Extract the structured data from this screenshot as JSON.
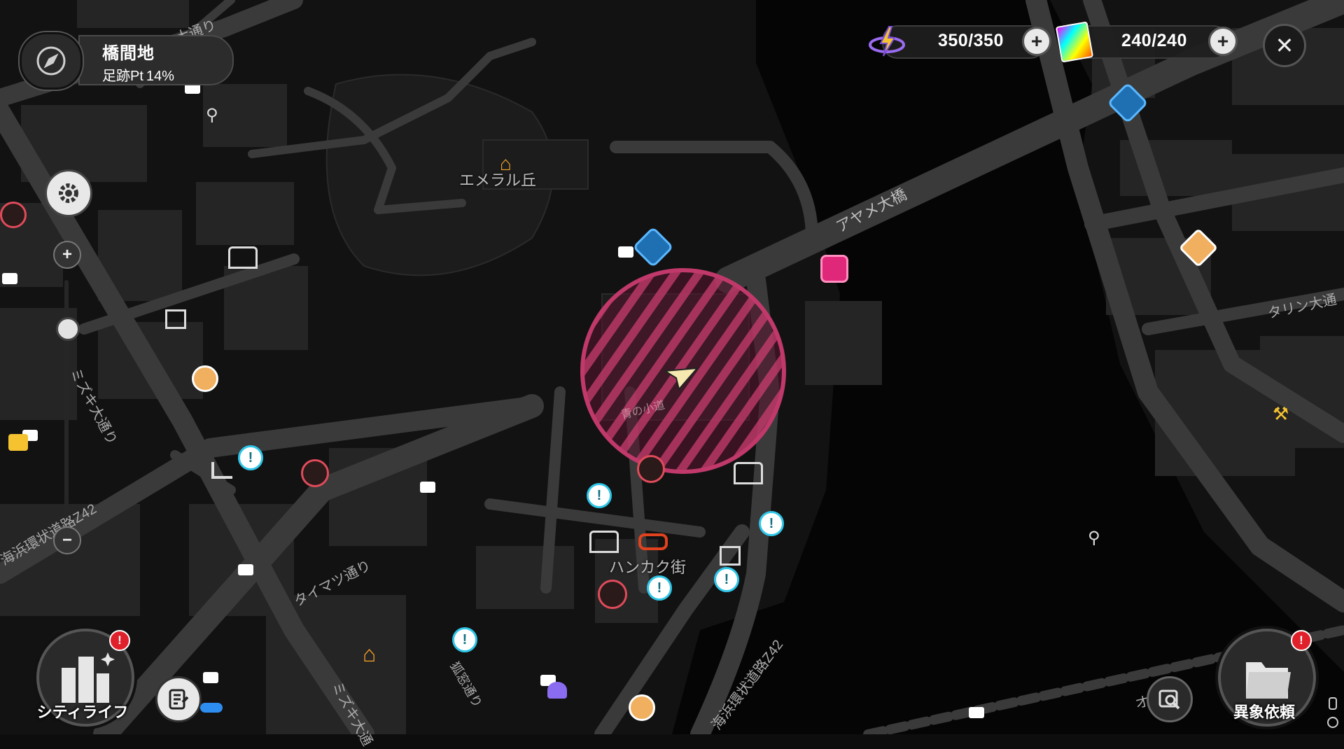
{
  "location": {
    "name": "橋間地",
    "footprint_label": "足跡Pt",
    "footprint_value": "14%"
  },
  "resources": [
    {
      "icon": "energy-crystal-icon",
      "value": "350/350"
    },
    {
      "icon": "card-pack-icon",
      "value": "240/240"
    }
  ],
  "map_labels": {
    "emerald_hill": "エメラル丘",
    "ayame_bridge": "アヤメ大橋",
    "hankaku_street": "ハンカク街",
    "mizuki_ave": "ミズキ大通り",
    "mizuki_ave_lower": "ミズキ大通",
    "taimatsu_st": "タイマツ通り",
    "kaihin_ring_left": "海浜環状道路Z42",
    "kaihin_ring_bottom": "海浜環状道路Z42",
    "talin_ave": "タリン大通",
    "top_ave": "大通り",
    "fox_st": "狐窓通り",
    "right_bottom_road": "オ　ト",
    "inside_circle": "青の小道"
  },
  "bottom_left": {
    "label": "シティライフ",
    "badge": "!"
  },
  "bottom_right": {
    "label": "異象依頼",
    "badge": "!"
  },
  "colors": {
    "target_circle": "#c0396a",
    "quest_marker": "#2ec6e8",
    "road": "#3a3a3a",
    "block": "#262626"
  }
}
